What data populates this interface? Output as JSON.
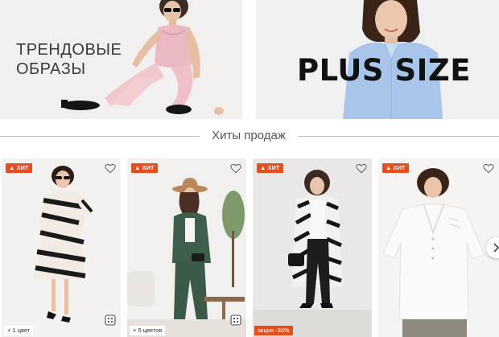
{
  "banners": {
    "left": {
      "title": "ТРЕНДОВЫЕ\nОБРАЗЫ"
    },
    "right": {
      "title": "PLUS SIZE"
    }
  },
  "section": {
    "title": "Хиты продаж"
  },
  "products": [
    {
      "badge": "ХИТ",
      "colors": "+ 1 цвет",
      "icons": [
        "heart-icon",
        "compare-icon"
      ]
    },
    {
      "badge": "ХИТ",
      "colors": "+ 5 цветов",
      "icons": [
        "heart-icon",
        "compare-icon"
      ]
    },
    {
      "badge": "ХИТ",
      "promo": "акция -36%",
      "icons": [
        "heart-icon"
      ]
    },
    {
      "badge": "ХИТ",
      "icons": [
        "heart-icon"
      ]
    }
  ],
  "colors": {
    "accent": "#ea4d1c",
    "divider": "#bdbdbd",
    "text": "#555555"
  },
  "carousel": {
    "next_icon": "chevron-right-icon"
  }
}
